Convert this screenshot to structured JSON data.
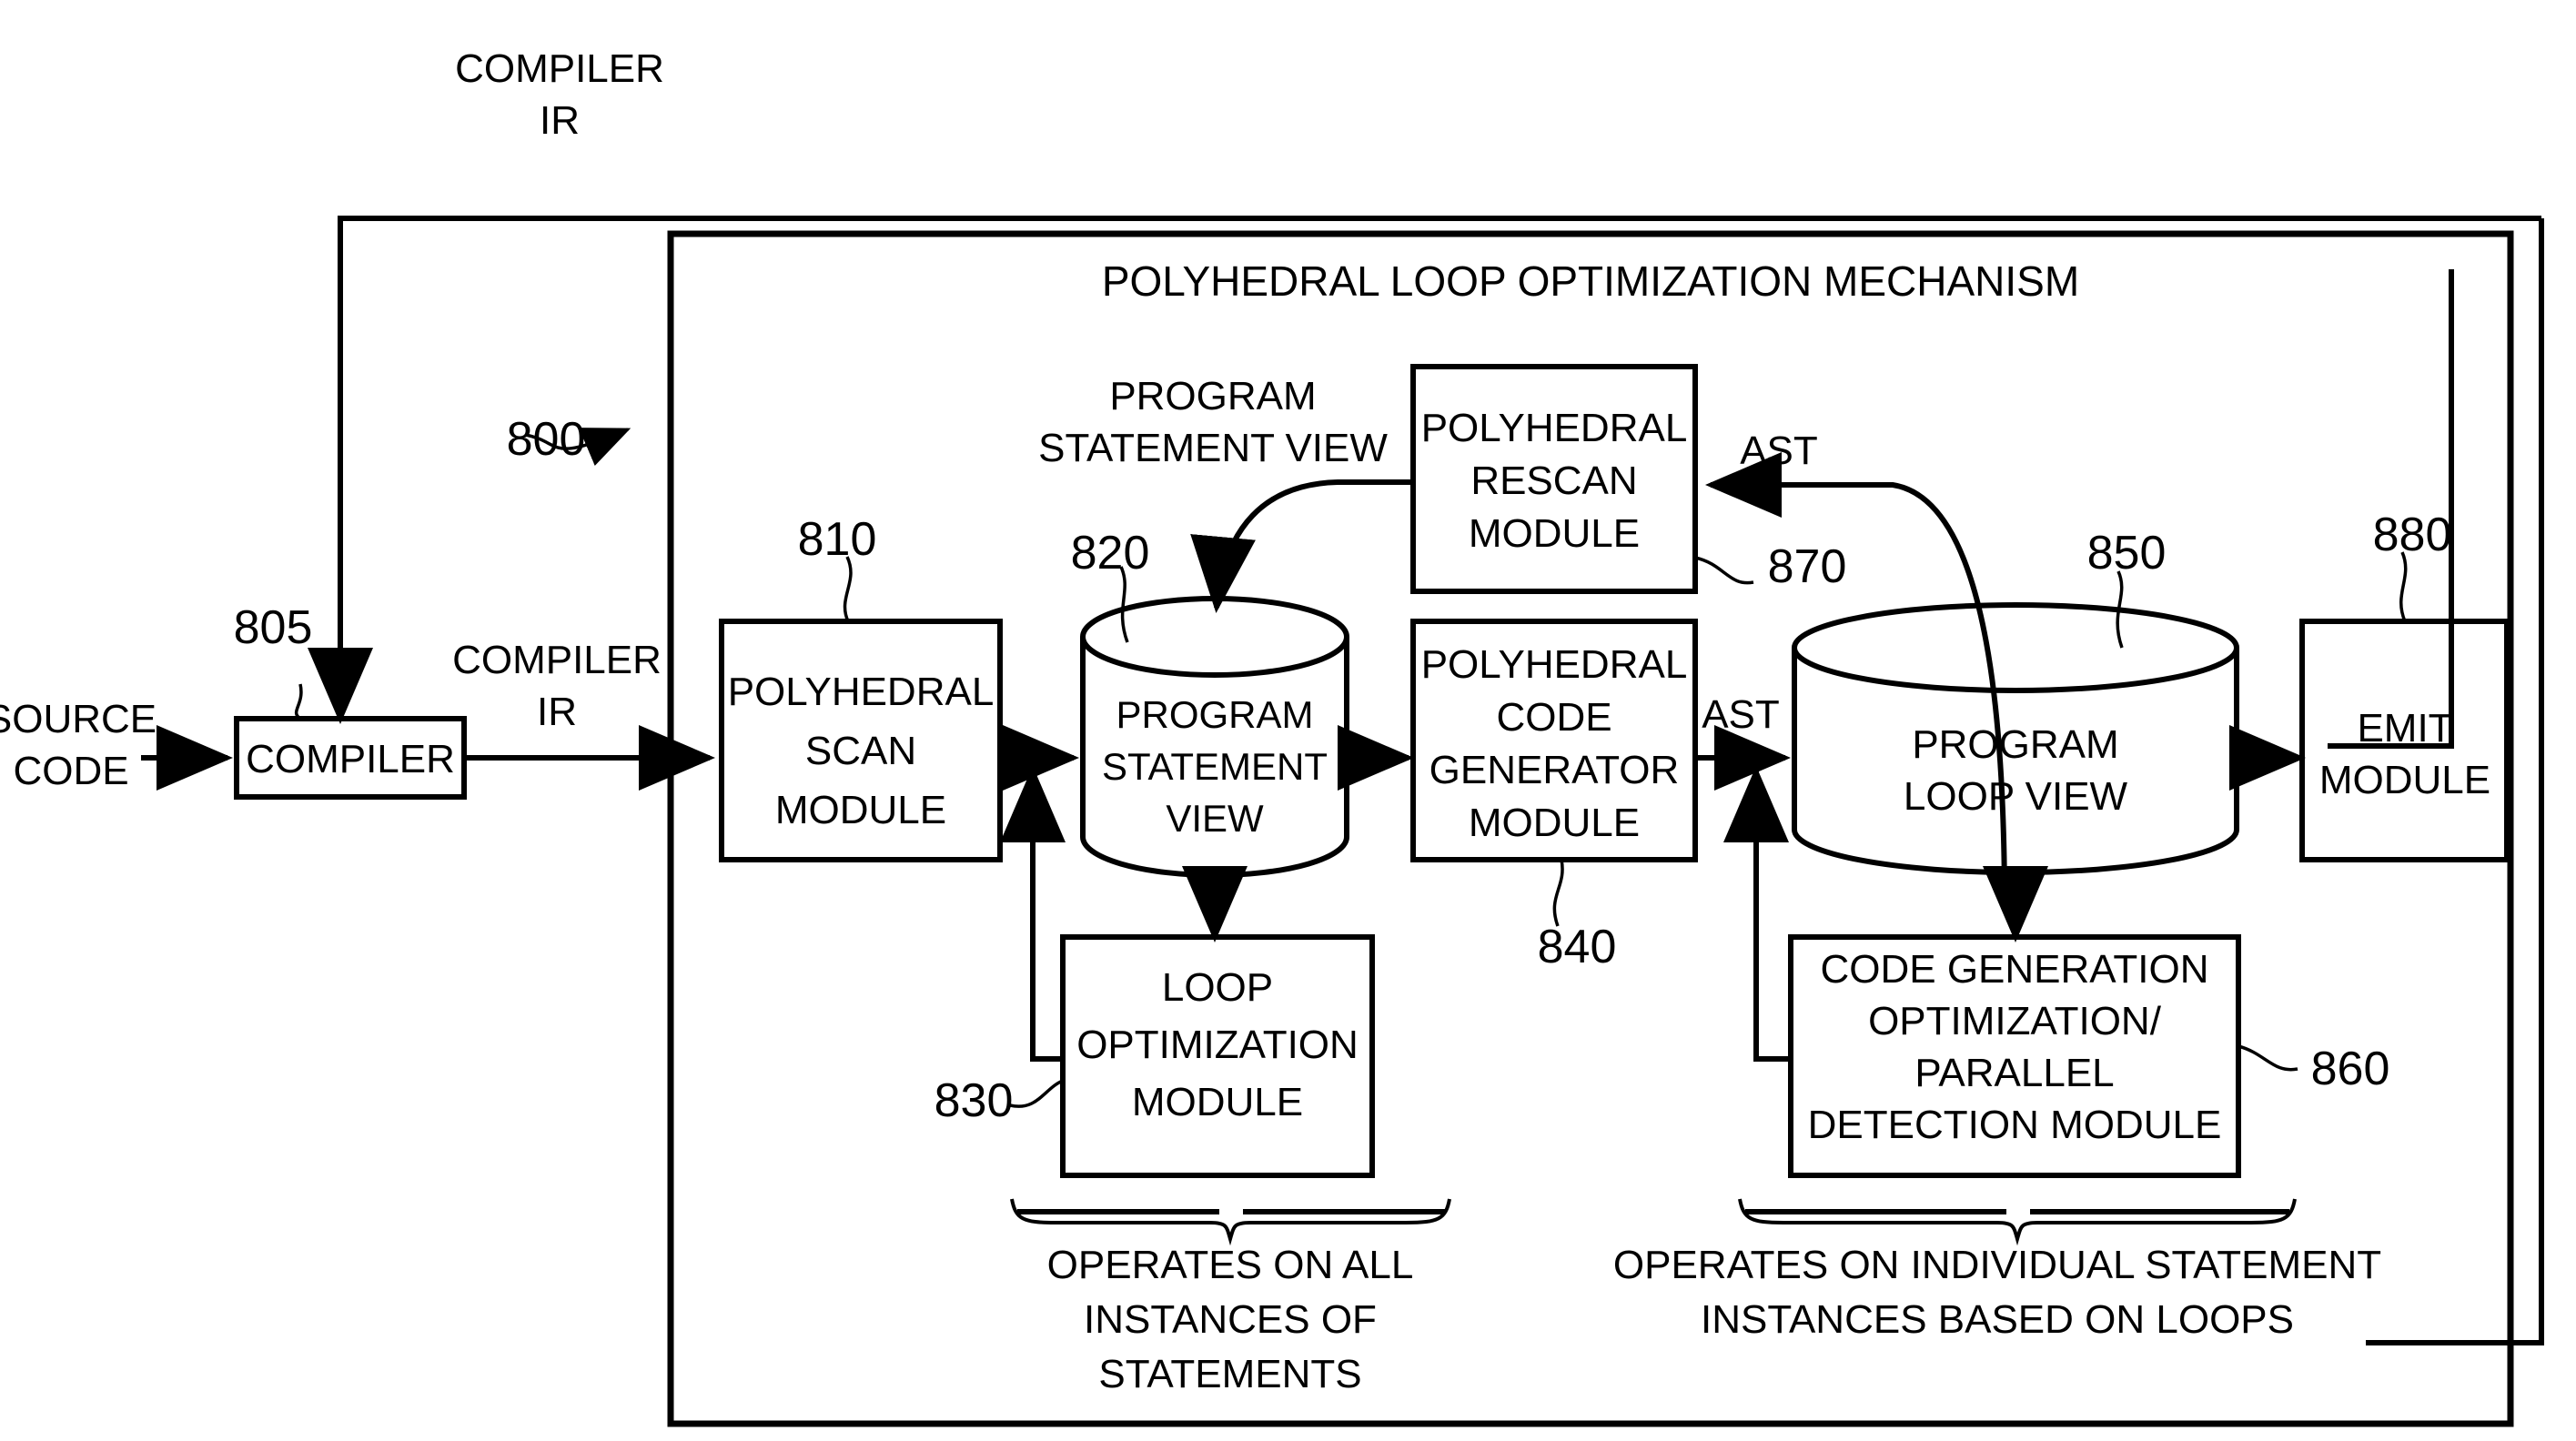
{
  "figure": {
    "title": "POLYHEDRAL LOOP OPTIMIZATION MECHANISM",
    "mechanism_ref": "800"
  },
  "external": {
    "source_code_label": "SOURCE\nCODE",
    "source_code_line1": "SOURCE",
    "source_code_line2": "CODE",
    "compiler_box": "COMPILER",
    "compiler_ref": "805",
    "compiler_ir_top_line1": "COMPILER",
    "compiler_ir_top_line2": "IR",
    "compiler_ir_mid_line1": "COMPILER",
    "compiler_ir_mid_line2": "IR"
  },
  "blocks": {
    "scan": {
      "line1": "POLYHEDRAL",
      "line2": "SCAN",
      "line3": "MODULE",
      "ref": "810"
    },
    "statement_view": {
      "line1": "PROGRAM",
      "line2": "STATEMENT",
      "line3": "VIEW",
      "ref": "820"
    },
    "loop_optimization": {
      "line1": "LOOP",
      "line2": "OPTIMIZATION",
      "line3": "MODULE",
      "ref": "830"
    },
    "code_generator": {
      "line1": "POLYHEDRAL",
      "line2": "CODE",
      "line3": "GENERATOR",
      "line4": "MODULE",
      "ref": "840"
    },
    "loop_view": {
      "line1": "PROGRAM",
      "line2": "LOOP VIEW",
      "ref": "850"
    },
    "codegen_opt": {
      "line1": "CODE GENERATION",
      "line2": "OPTIMIZATION/",
      "line3": "PARALLEL",
      "line4": "DETECTION MODULE",
      "ref": "860"
    },
    "rescan": {
      "line1": "POLYHEDRAL",
      "line2": "RESCAN",
      "line3": "MODULE",
      "ref": "870"
    },
    "emit": {
      "line1": "EMIT",
      "line2": "MODULE",
      "ref": "880"
    }
  },
  "edge_labels": {
    "program_statement_view_line1": "PROGRAM",
    "program_statement_view_line2": "STATEMENT VIEW",
    "ast_top": "AST",
    "ast_mid": "AST"
  },
  "captions": {
    "left_line1": "OPERATES ON ALL",
    "left_line2": "INSTANCES OF",
    "left_line3": "STATEMENTS",
    "right_line1": "OPERATES ON INDIVIDUAL STATEMENT",
    "right_line2": "INSTANCES BASED ON LOOPS"
  },
  "colors": {
    "stroke": "#000000",
    "background": "#ffffff"
  }
}
